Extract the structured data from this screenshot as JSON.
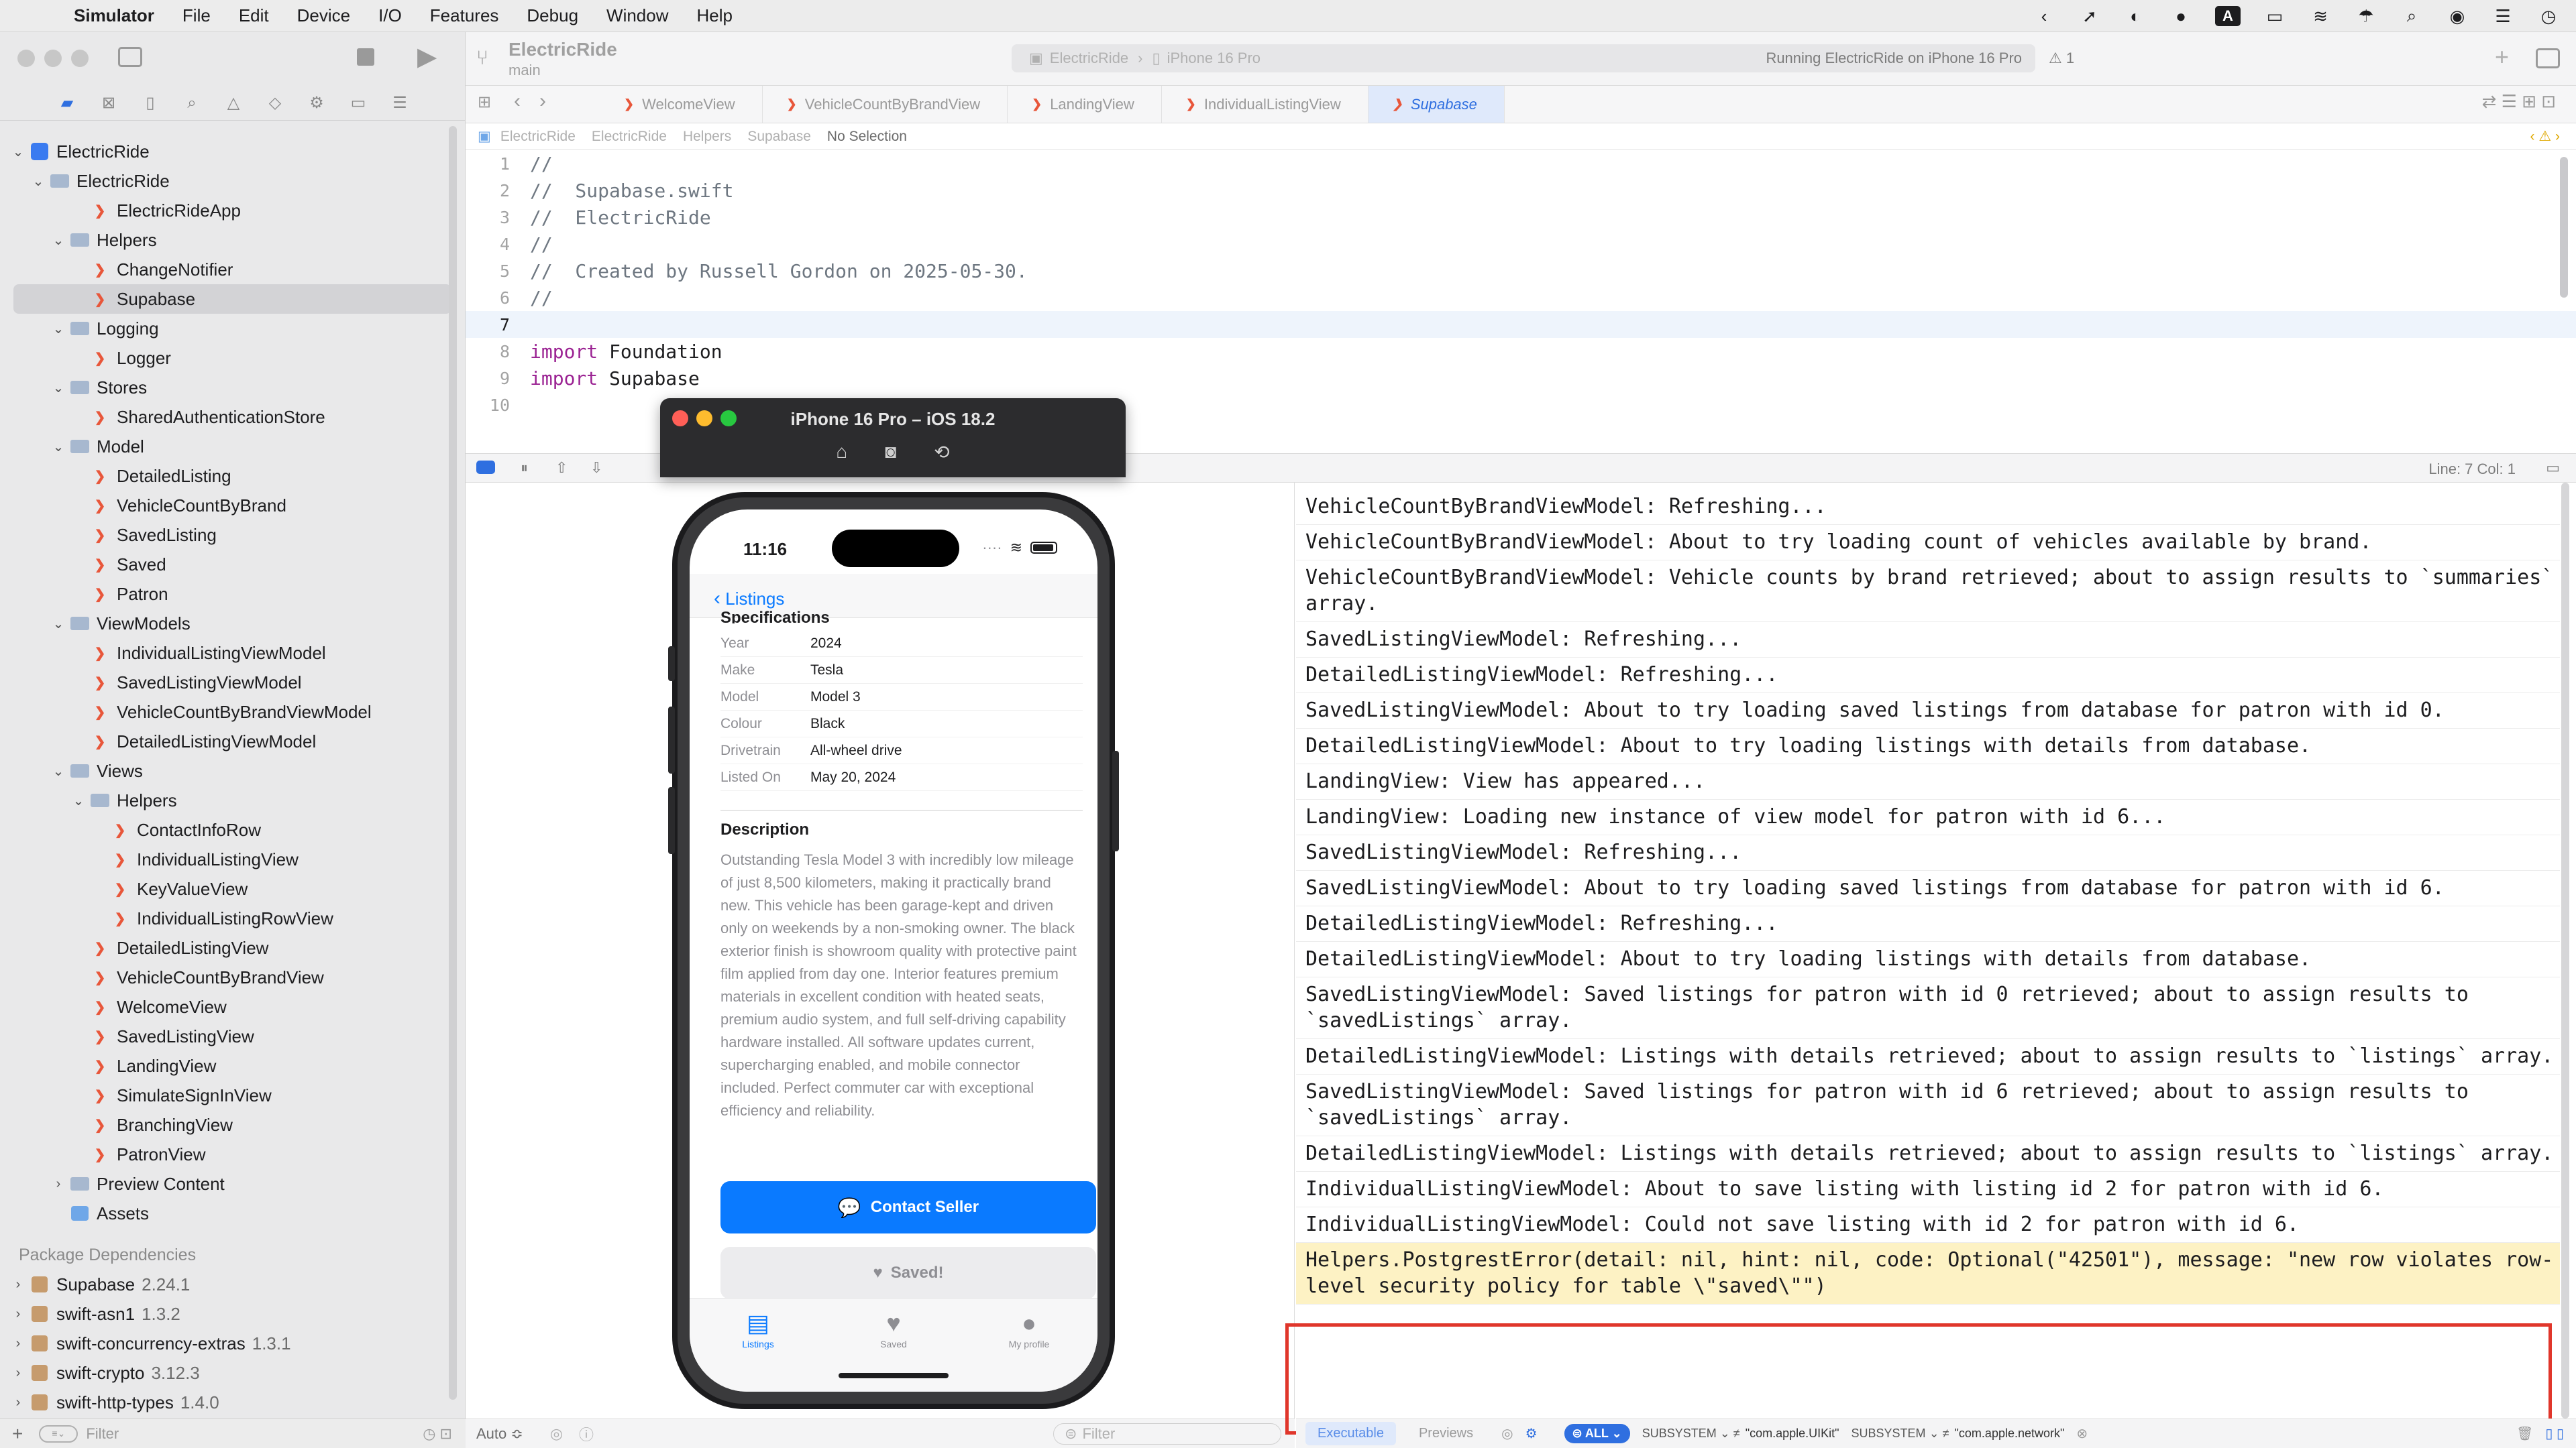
{
  "menubar": {
    "app": "Simulator",
    "items": [
      "File",
      "Edit",
      "Device",
      "I/O",
      "Features",
      "Debug",
      "Window",
      "Help"
    ],
    "status_boxed": "A"
  },
  "navigator": {
    "project": "ElectricRide",
    "tree": [
      {
        "label": "ElectricRide",
        "indent": 1,
        "kind": "folder",
        "open": true
      },
      {
        "label": "ElectricRideApp",
        "indent": 3,
        "kind": "swift"
      },
      {
        "label": "Helpers",
        "indent": 2,
        "kind": "folder",
        "open": true
      },
      {
        "label": "ChangeNotifier",
        "indent": 3,
        "kind": "swift"
      },
      {
        "label": "Supabase",
        "indent": 3,
        "kind": "swift",
        "selected": true
      },
      {
        "label": "Logging",
        "indent": 2,
        "kind": "folder",
        "open": true
      },
      {
        "label": "Logger",
        "indent": 3,
        "kind": "swift"
      },
      {
        "label": "Stores",
        "indent": 2,
        "kind": "folder",
        "open": true
      },
      {
        "label": "SharedAuthenticationStore",
        "indent": 3,
        "kind": "swift"
      },
      {
        "label": "Model",
        "indent": 2,
        "kind": "folder",
        "open": true
      },
      {
        "label": "DetailedListing",
        "indent": 3,
        "kind": "swift"
      },
      {
        "label": "VehicleCountByBrand",
        "indent": 3,
        "kind": "swift"
      },
      {
        "label": "SavedListing",
        "indent": 3,
        "kind": "swift"
      },
      {
        "label": "Saved",
        "indent": 3,
        "kind": "swift"
      },
      {
        "label": "Patron",
        "indent": 3,
        "kind": "swift"
      },
      {
        "label": "ViewModels",
        "indent": 2,
        "kind": "folder",
        "open": true
      },
      {
        "label": "IndividualListingViewModel",
        "indent": 3,
        "kind": "swift"
      },
      {
        "label": "SavedListingViewModel",
        "indent": 3,
        "kind": "swift"
      },
      {
        "label": "VehicleCountByBrandViewModel",
        "indent": 3,
        "kind": "swift"
      },
      {
        "label": "DetailedListingViewModel",
        "indent": 3,
        "kind": "swift"
      },
      {
        "label": "Views",
        "indent": 2,
        "kind": "folder",
        "open": true
      },
      {
        "label": "Helpers",
        "indent": 3,
        "kind": "folder",
        "open": true
      },
      {
        "label": "ContactInfoRow",
        "indent": 4,
        "kind": "swift"
      },
      {
        "label": "IndividualListingView",
        "indent": 4,
        "kind": "swift"
      },
      {
        "label": "KeyValueView",
        "indent": 4,
        "kind": "swift"
      },
      {
        "label": "IndividualListingRowView",
        "indent": 4,
        "kind": "swift"
      },
      {
        "label": "DetailedListingView",
        "indent": 3,
        "kind": "swift"
      },
      {
        "label": "VehicleCountByBrandView",
        "indent": 3,
        "kind": "swift"
      },
      {
        "label": "WelcomeView",
        "indent": 3,
        "kind": "swift"
      },
      {
        "label": "SavedListingView",
        "indent": 3,
        "kind": "swift"
      },
      {
        "label": "LandingView",
        "indent": 3,
        "kind": "swift"
      },
      {
        "label": "SimulateSignInView",
        "indent": 3,
        "kind": "swift"
      },
      {
        "label": "BranchingView",
        "indent": 3,
        "kind": "swift"
      },
      {
        "label": "PatronView",
        "indent": 3,
        "kind": "swift"
      },
      {
        "label": "Preview Content",
        "indent": 2,
        "kind": "folder",
        "open": false
      },
      {
        "label": "Assets",
        "indent": 2,
        "kind": "assets"
      }
    ],
    "packages_heading": "Package Dependencies",
    "packages": [
      {
        "name": "Supabase",
        "version": "2.24.1"
      },
      {
        "name": "swift-asn1",
        "version": "1.3.2"
      },
      {
        "name": "swift-concurrency-extras",
        "version": "1.3.1"
      },
      {
        "name": "swift-crypto",
        "version": "3.12.3"
      },
      {
        "name": "swift-http-types",
        "version": "1.4.0"
      }
    ],
    "filter_placeholder": "Filter"
  },
  "toolbar": {
    "project": "ElectricRide",
    "branch": "main",
    "scheme": "ElectricRide",
    "device": "iPhone 16 Pro",
    "run_status": "Running ElectricRide on iPhone 16 Pro",
    "warnings": "1"
  },
  "tabs": [
    "WelcomeView",
    "VehicleCountByBrandView",
    "LandingView",
    "IndividualListingView",
    "Supabase"
  ],
  "active_tab": "Supabase",
  "jumpbar": [
    "ElectricRide",
    "ElectricRide",
    "Helpers",
    "Supabase",
    "No Selection"
  ],
  "code": {
    "lines": [
      {
        "n": "1",
        "parts": [
          {
            "t": "//",
            "c": "comment"
          }
        ]
      },
      {
        "n": "2",
        "parts": [
          {
            "t": "//  Supabase.swift",
            "c": "comment"
          }
        ]
      },
      {
        "n": "3",
        "parts": [
          {
            "t": "//  ElectricRide",
            "c": "comment"
          }
        ]
      },
      {
        "n": "4",
        "parts": [
          {
            "t": "//",
            "c": "comment"
          }
        ]
      },
      {
        "n": "5",
        "parts": [
          {
            "t": "//  Created by Russell Gordon on 2025-05-30.",
            "c": "comment"
          }
        ]
      },
      {
        "n": "6",
        "parts": [
          {
            "t": "//",
            "c": "comment"
          }
        ]
      },
      {
        "n": "7",
        "parts": [],
        "current": true
      },
      {
        "n": "8",
        "parts": [
          {
            "t": "import",
            "c": "kw"
          },
          {
            "t": " Foundation",
            "c": "plain"
          }
        ]
      },
      {
        "n": "9",
        "parts": [
          {
            "t": "import",
            "c": "kw"
          },
          {
            "t": " Supabase",
            "c": "plain"
          }
        ]
      },
      {
        "n": "10",
        "parts": []
      }
    ]
  },
  "debugbar": {
    "line_col": "Line: 7  Col: 1"
  },
  "vars": {
    "auto_label": "Auto ≎",
    "filter_placeholder": "Filter"
  },
  "console": {
    "logs": [
      {
        "text": "VehicleCountByBrandViewModel: Refreshing..."
      },
      {
        "text": "VehicleCountByBrandViewModel: About to try loading count of vehicles available by brand."
      },
      {
        "text": "VehicleCountByBrandViewModel: Vehicle counts by brand retrieved; about to assign results to `summaries` array."
      },
      {
        "text": "SavedListingViewModel: Refreshing..."
      },
      {
        "text": "DetailedListingViewModel: Refreshing..."
      },
      {
        "text": "SavedListingViewModel: About to try loading saved listings from database for patron with id 0."
      },
      {
        "text": "DetailedListingViewModel: About to try loading listings with details from database."
      },
      {
        "text": "LandingView: View has appeared..."
      },
      {
        "text": "LandingView: Loading new instance of view model for patron with id 6..."
      },
      {
        "text": "SavedListingViewModel: Refreshing..."
      },
      {
        "text": "SavedListingViewModel: About to try loading saved listings from database for patron with id 6."
      },
      {
        "text": "DetailedListingViewModel: Refreshing..."
      },
      {
        "text": "DetailedListingViewModel: About to try loading listings with details from database."
      },
      {
        "text": "SavedListingViewModel: Saved listings for patron with id 0 retrieved; about to assign results to `savedListings` array."
      },
      {
        "text": "DetailedListingViewModel: Listings with details retrieved; about to assign results to `listings` array."
      },
      {
        "text": "SavedListingViewModel: Saved listings for patron with id 6 retrieved; about to assign results to `savedListings` array."
      },
      {
        "text": "DetailedListingViewModel: Listings with details retrieved; about to assign results to `listings` array."
      },
      {
        "text": "IndividualListingViewModel: About to save listing with listing id 2 for patron with id 6."
      },
      {
        "text": "IndividualListingViewModel: Could not save listing with id 2 for patron with id 6."
      },
      {
        "text": "Helpers.PostgrestError(detail: nil, hint: nil, code: Optional(\"42501\"), message: \"new row violates row-level security policy for table \\\"saved\\\"\")",
        "highlight": true
      }
    ],
    "footer": {
      "executable": "Executable",
      "previews": "Previews",
      "all": "ALL",
      "subsystem_label": "SUBSYSTEM",
      "subsystem_uikit": "\"com.apple.UIKit\"",
      "subsystem_network": "\"com.apple.network\""
    }
  },
  "simulator": {
    "title": "iPhone 16 Pro – iOS 18.2",
    "time": "11:16",
    "back_label": "Listings",
    "spec_heading": "Specifications",
    "specs": [
      {
        "key": "Year",
        "value": "2024"
      },
      {
        "key": "Make",
        "value": "Tesla"
      },
      {
        "key": "Model",
        "value": "Model 3"
      },
      {
        "key": "Colour",
        "value": "Black"
      },
      {
        "key": "Drivetrain",
        "value": "All-wheel drive"
      },
      {
        "key": "Listed On",
        "value": "May 20, 2024"
      }
    ],
    "description_heading": "Description",
    "description": "Outstanding Tesla Model 3 with incredibly low mileage of just 8,500 kilometers, making it practically brand new. This vehicle has been garage-kept and driven only on weekends by a non-smoking owner. The black exterior finish is showroom quality with protective paint film applied from day one. Interior features premium materials in excellent condition with heated seats, premium audio system, and full self-driving capability hardware installed. All software updates current, supercharging enabled, and mobile connector included. Perfect commuter car with exceptional efficiency and reliability.",
    "contact_button": "Contact Seller",
    "saved_button": "Saved!",
    "tabs": [
      "Listings",
      "Saved",
      "My profile"
    ]
  }
}
